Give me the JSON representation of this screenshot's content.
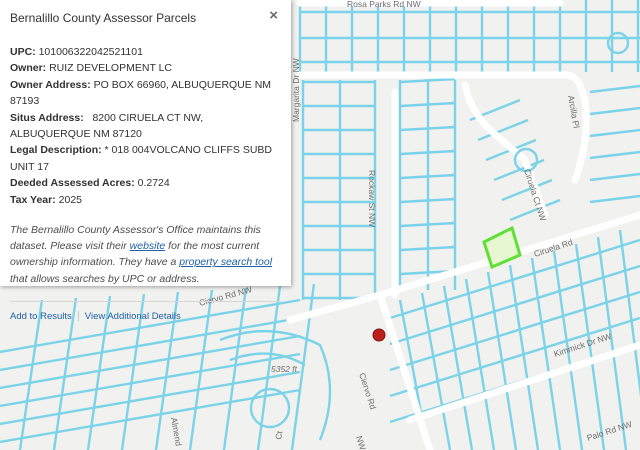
{
  "map": {
    "road_labels": {
      "rosa_parks": "Rosa Parks Rd NW",
      "arcilla": "Arcilla Pl",
      "margarita": "Margarita Dr NW",
      "rockaw": "Rockaw St NW",
      "ciruela_ct": "Ciruela Ct NW",
      "ciruela_rd": "Ciruela Rd",
      "ciervo_rd_nw": "Ciervo Rd NW",
      "ciervo_rd": "Ciervo Rd",
      "kimmick": "Kimmick Dr NW",
      "palo": "Palo Rd NW",
      "almendro": "Almend",
      "ct": "Ct",
      "nw": "NW"
    },
    "elevation": "5352 ft",
    "colors": {
      "parcel": "#7ad3e8",
      "selected": "#5ee035",
      "marker": "#c0201c",
      "road": "#ffffff",
      "background": "#f1f1ef"
    }
  },
  "popup": {
    "title": "Bernalillo County Assessor Parcels",
    "close_icon": "close-icon",
    "fields": [
      {
        "label": "UPC:",
        "value": " 101006322042521101"
      },
      {
        "label": "Owner:",
        "value": " RUIZ DEVELOPMENT LC"
      },
      {
        "label": "Owner Address:",
        "value": " PO BOX 66960, ALBUQUERQUE NM 87193"
      },
      {
        "label": "Situs Address:",
        "value": "   8200 CIRUELA CT NW, ALBUQUERQUE NM 87120"
      },
      {
        "label": "Legal Description:",
        "value": " * 018 004VOLCANO CLIFFS SUBD UNIT 17"
      },
      {
        "label": "Deeded Assessed Acres:",
        "value": " 0.2724"
      },
      {
        "label": "Tax Year:",
        "value": " 2025"
      }
    ],
    "note": {
      "part1": "The Bernalillo County Assessor's Office maintains this dataset. Please visit their ",
      "link1": "website",
      "part2": " for the most current ownership information. They have a ",
      "link2": "property search tool",
      "part3": " that allows searches by UPC or address."
    },
    "actions": {
      "add": "Add to Results",
      "details": "View Additional Details"
    }
  }
}
